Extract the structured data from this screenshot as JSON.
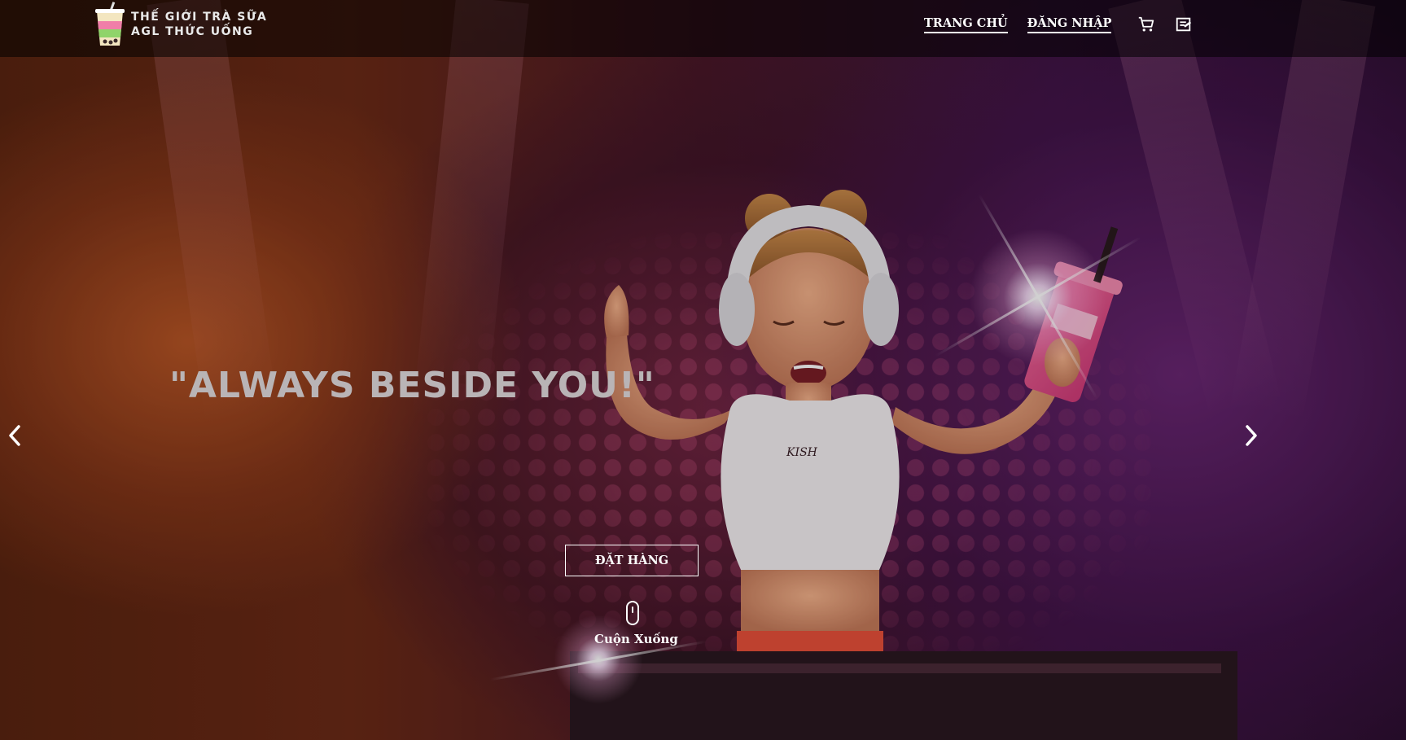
{
  "brand": {
    "line1": "THẾ GIỚI TRÀ SỮA",
    "line2": "AGL THỨC UỐNG"
  },
  "nav": {
    "home_label": "TRANG CHỦ",
    "login_label": "ĐĂNG NHẬP",
    "cart_icon": "cart-icon",
    "history_icon": "order-history-icon"
  },
  "hero": {
    "tagline": "\"ALWAYS BESIDE YOU!\"",
    "shirt_text": "KISH",
    "order_button": "ĐẶT HÀNG",
    "scroll_label": "Cuộn Xuống",
    "prev_icon": "chevron-left-icon",
    "next_icon": "chevron-right-icon"
  }
}
